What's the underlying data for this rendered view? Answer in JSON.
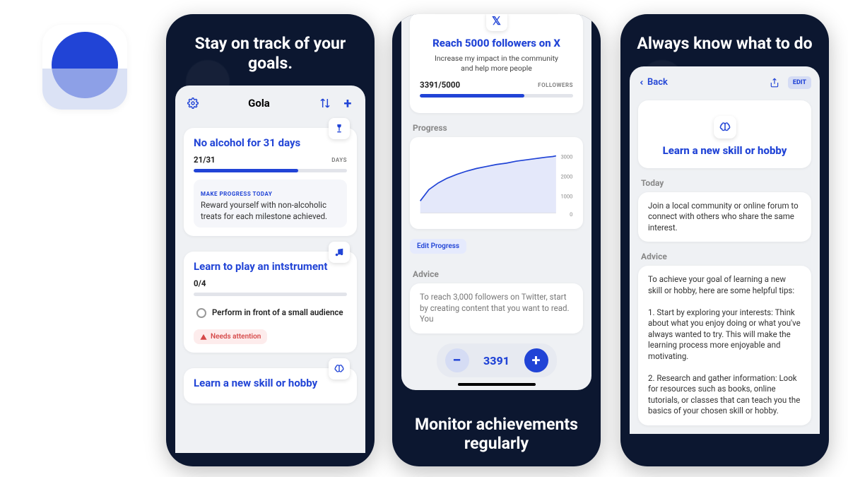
{
  "headlines": {
    "p1": "Stay on track of your goals.",
    "p2": "Monitor achievements regularly",
    "p3": "Always know what to do"
  },
  "screen1": {
    "app_title": "Gola",
    "card1": {
      "title": "No alcohol for 31 days",
      "progress": "21/31",
      "unit": "DAYS",
      "bar_pct": 68,
      "subhead": "MAKE PROGRESS TODAY",
      "tip": "Reward yourself with non-alcoholic treats for each milestone achieved."
    },
    "card2": {
      "title": "Learn to play an intstrument",
      "progress": "0/4",
      "bar_pct": 0,
      "todo": "Perform in front of a small audience",
      "attention": "Needs attention"
    },
    "card3": {
      "title": "Learn a new skill or hobby"
    }
  },
  "screen2": {
    "goal_title": "Reach 5000 followers on X",
    "goal_sub": "Increase my impact in the community and help more people",
    "count": "3391/5000",
    "unit": "FOLLOWERS",
    "bar_pct": 68,
    "progress_label": "Progress",
    "edit_label": "Edit Progress",
    "advice_label": "Advice",
    "advice_text": "To reach 3,000 followers on Twitter, start by creating                                        content that you                                                 want to read. You",
    "stepper_value": "3391"
  },
  "screen3": {
    "back": "Back",
    "edit": "EDIT",
    "goal_title": "Learn a new skill or hobby",
    "today_label": "Today",
    "today_text": "Join a local community or online forum to connect with others who share the same interest.",
    "advice_label": "Advice",
    "advice_text": "To achieve your goal of learning a new skill or hobby, here are some helpful tips:\n\n1. Start by exploring your interests: Think about what you enjoy doing or what you've always wanted to try. This will make the learning process more enjoyable and motivating.\n\n2. Research and gather information: Look for resources such as books, online tutorials, or classes that can teach you the basics of your chosen skill or hobby."
  },
  "chart_data": {
    "type": "line",
    "ylabel": "",
    "ylim": [
      0,
      3000
    ],
    "y_ticks": [
      0,
      1000,
      2000,
      3000
    ],
    "values": [
      600,
      1100,
      1400,
      1700,
      1900,
      2100,
      2250,
      2400,
      2500,
      2600,
      2700,
      2780,
      2850,
      2900,
      2950,
      3000
    ]
  }
}
